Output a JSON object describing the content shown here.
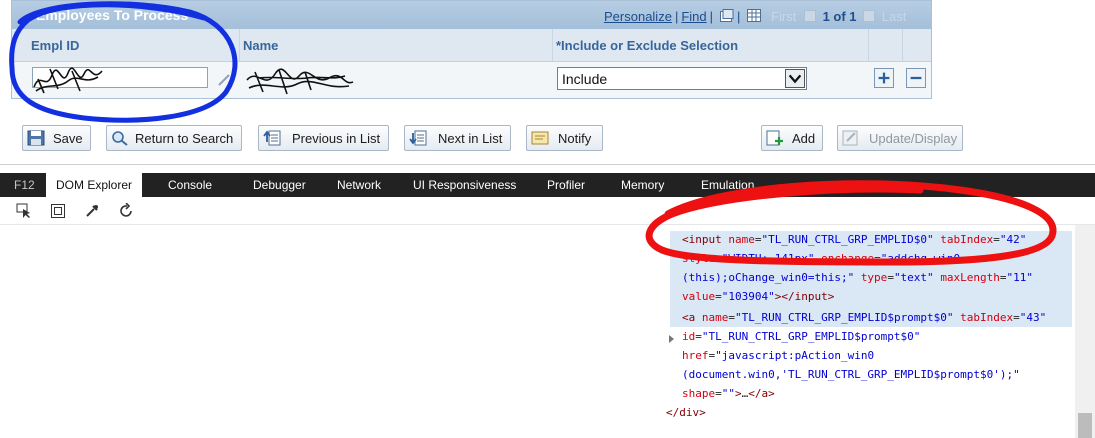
{
  "grid": {
    "title": "Employees To Process",
    "nav": {
      "personalize": "Personalize",
      "find": "Find",
      "first": "First",
      "count": "1 of 1",
      "last": "Last",
      "sep": "|"
    },
    "columns": {
      "emplid": "Empl ID",
      "name": "Name",
      "include": "*Include or Exclude Selection"
    },
    "row": {
      "emplid_value": "",
      "select_value": "Include"
    }
  },
  "buttons": {
    "save": "Save",
    "return_search": "Return to Search",
    "previous": "Previous in List",
    "next": "Next in List",
    "notify": "Notify",
    "add": "Add",
    "update": "Update/Display"
  },
  "devtools": {
    "f12": "F12",
    "tabs": [
      "DOM Explorer",
      "Console",
      "Debugger",
      "Network",
      "UI Responsiveness",
      "Profiler",
      "Memory",
      "Emulation"
    ],
    "code_lines": [
      {
        "indent": 682,
        "parts": [
          [
            "t",
            "<input "
          ],
          [
            "a",
            "name"
          ],
          [
            "",
            "="
          ],
          [
            "v",
            "\"TL_RUN_CTRL_GRP_EMPLID$0\""
          ],
          [
            "",
            " "
          ],
          [
            "a",
            "tabIndex"
          ],
          [
            "",
            "="
          ],
          [
            "v",
            "\"42\""
          ]
        ]
      },
      {
        "indent": 682,
        "parts": [
          [
            "a",
            "style"
          ],
          [
            "",
            "="
          ],
          [
            "v",
            "\"WIDTH: 141px\""
          ],
          [
            "",
            " "
          ],
          [
            "a",
            "onchange"
          ],
          [
            "",
            "="
          ],
          [
            "v",
            "\"addchg_win0"
          ]
        ]
      },
      {
        "indent": 682,
        "parts": [
          [
            "v",
            "(this);oChange_win0=this;\""
          ],
          [
            "",
            " "
          ],
          [
            "a",
            "type"
          ],
          [
            "",
            "="
          ],
          [
            "v",
            "\"text\""
          ],
          [
            "",
            " "
          ],
          [
            "a",
            "maxLength"
          ],
          [
            "",
            "="
          ],
          [
            "v",
            "\"11\""
          ]
        ]
      },
      {
        "indent": 682,
        "parts": [
          [
            "a",
            "value"
          ],
          [
            "",
            "="
          ],
          [
            "v",
            "\"103904\""
          ],
          [
            "t",
            "></input>"
          ]
        ]
      },
      {
        "indent": 682,
        "parts": [
          [
            "t",
            "<a "
          ],
          [
            "a",
            "name"
          ],
          [
            "",
            "="
          ],
          [
            "v",
            "\"TL_RUN_CTRL_GRP_EMPLID$prompt$0\""
          ],
          [
            "",
            " "
          ],
          [
            "a",
            "tabIndex"
          ],
          [
            "",
            "="
          ],
          [
            "v",
            "\"43\""
          ]
        ]
      },
      {
        "indent": 682,
        "parts": [
          [
            "a",
            "id"
          ],
          [
            "",
            "="
          ],
          [
            "v",
            "\"TL_RUN_CTRL_GRP_EMPLID$prompt$0\""
          ]
        ]
      },
      {
        "indent": 682,
        "parts": [
          [
            "a",
            "href"
          ],
          [
            "",
            "="
          ],
          [
            "v",
            "\"javascript:pAction_win0"
          ]
        ]
      },
      {
        "indent": 682,
        "parts": [
          [
            "v",
            "(document.win0,'TL_RUN_CTRL_GRP_EMPLID$prompt$0');\""
          ]
        ]
      },
      {
        "indent": 682,
        "parts": [
          [
            "a",
            "shape"
          ],
          [
            "",
            "="
          ],
          [
            "v",
            "\"\""
          ],
          [
            "t",
            ">"
          ],
          [
            "",
            "…"
          ],
          [
            "t",
            "</a>"
          ]
        ]
      },
      {
        "indent": 666,
        "parts": [
          [
            "t",
            "</div>"
          ]
        ]
      }
    ]
  },
  "colors": {
    "annotation_blue": "#1230e0",
    "annotation_red": "#ee1111"
  }
}
